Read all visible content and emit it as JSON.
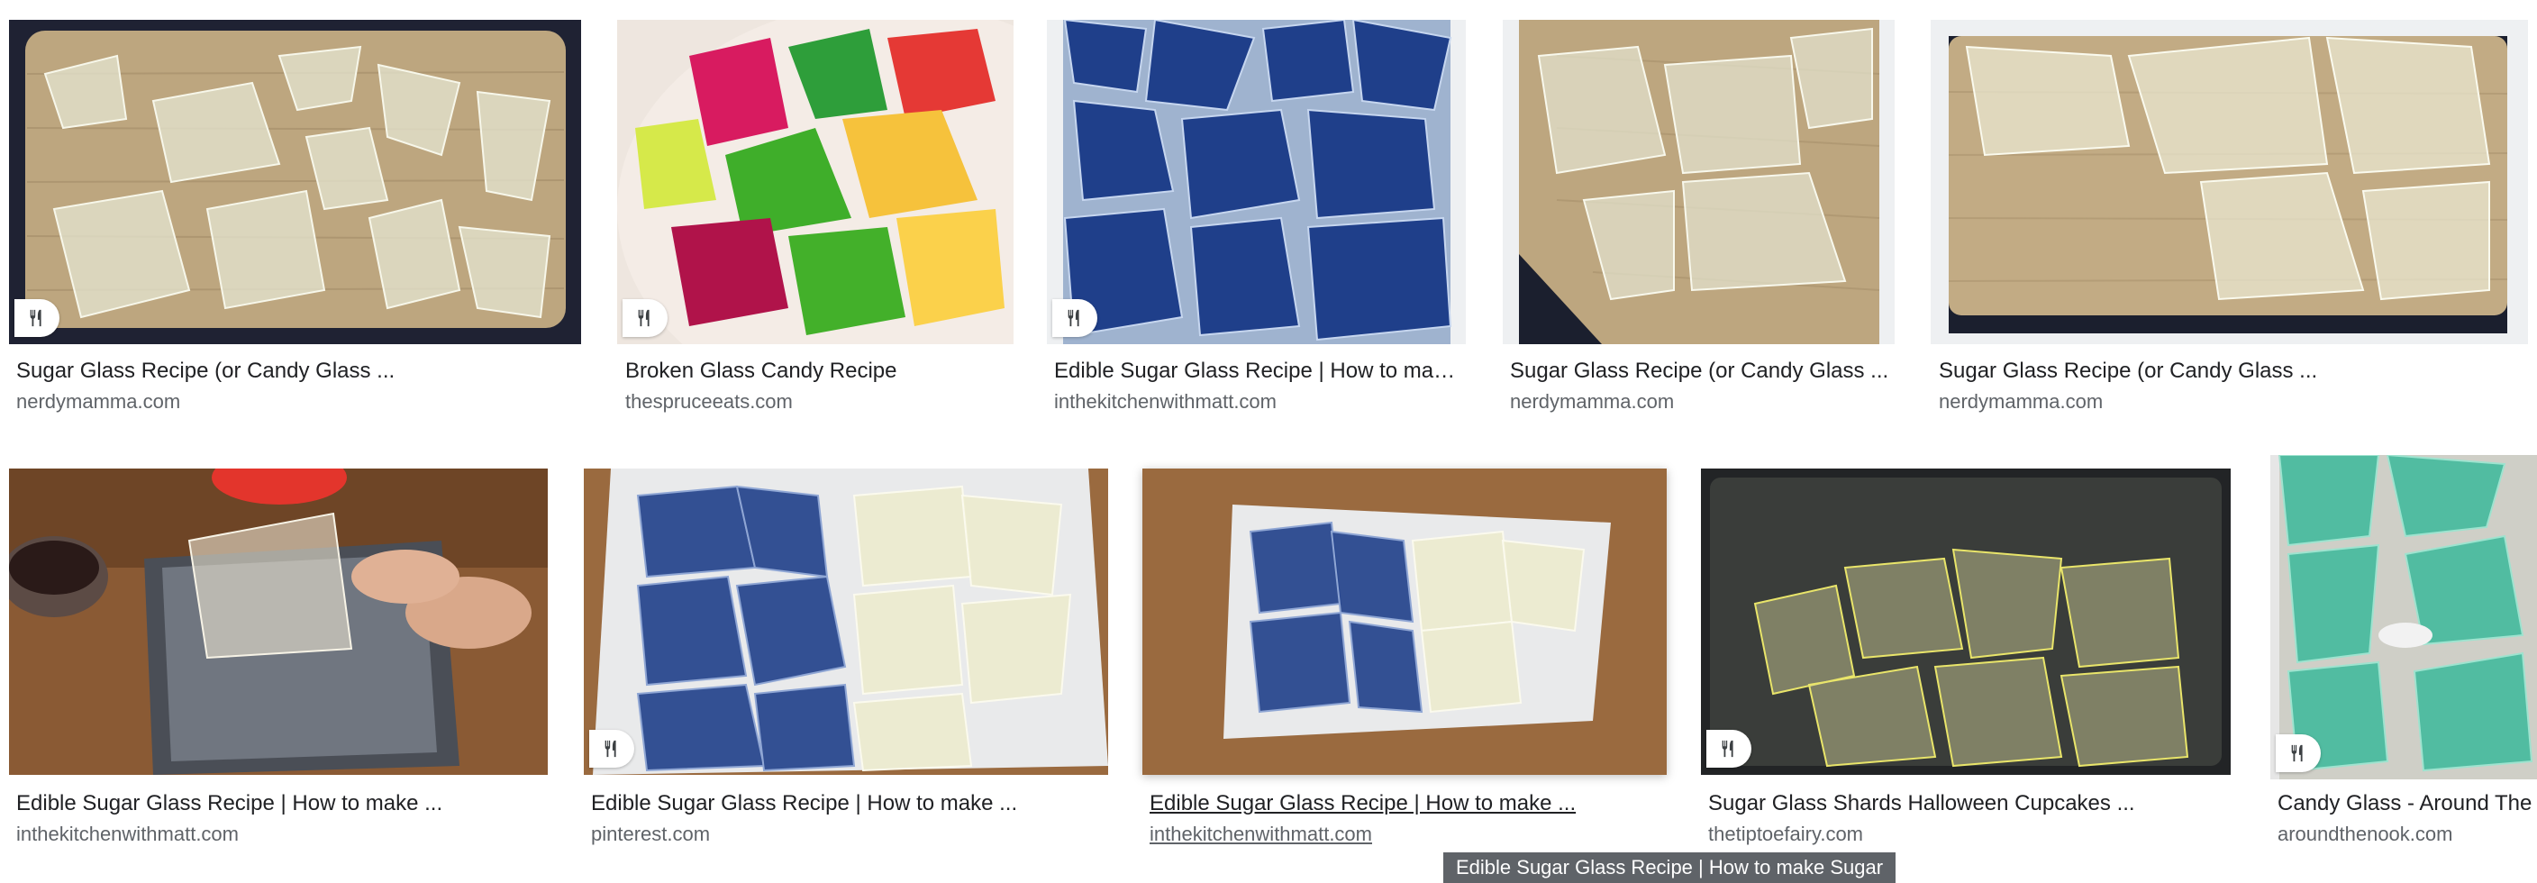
{
  "results": [
    {
      "title": "Sugar Glass Recipe (or Candy Glass ...",
      "domain": "nerdymamma.com",
      "recipe": true
    },
    {
      "title": "Broken Glass Candy Recipe",
      "domain": "thespruceeats.com",
      "recipe": true
    },
    {
      "title": "Edible Sugar Glass Recipe | How to make ...",
      "domain": "inthekitchenwithmatt.com",
      "recipe": true
    },
    {
      "title": "Sugar Glass Recipe (or Candy Glass ...",
      "domain": "nerdymamma.com",
      "recipe": false
    },
    {
      "title": "Sugar Glass Recipe (or Candy Glass ...",
      "domain": "nerdymamma.com",
      "recipe": false
    },
    {
      "title": "Edible Sugar Glass Recipe | How to make ...",
      "domain": "inthekitchenwithmatt.com",
      "recipe": false
    },
    {
      "title": "Edible Sugar Glass Recipe | How to make ...",
      "domain": "pinterest.com",
      "recipe": true
    },
    {
      "title": "Edible Sugar Glass Recipe | How to make ...",
      "domain": "inthekitchenwithmatt.com",
      "recipe": false,
      "hovered": true
    },
    {
      "title": "Sugar Glass Shards Halloween Cupcakes ...",
      "domain": "thetiptoefairy.com",
      "recipe": true
    },
    {
      "title": "Candy Glass - Around The Nook",
      "domain": "aroundthenook.com",
      "recipe": true
    }
  ],
  "tooltip": "Edible Sugar Glass Recipe | How to make Sugar",
  "icon": "fork-knife-icon",
  "colors": {
    "title": "#202124",
    "domain": "#5f6368",
    "tooltip_bg": "#5f6368",
    "wood": "#b49b78",
    "dark_navy": "#1e2233",
    "blue_glass": "#1f3f8a",
    "plate": "#e8e9ea"
  }
}
